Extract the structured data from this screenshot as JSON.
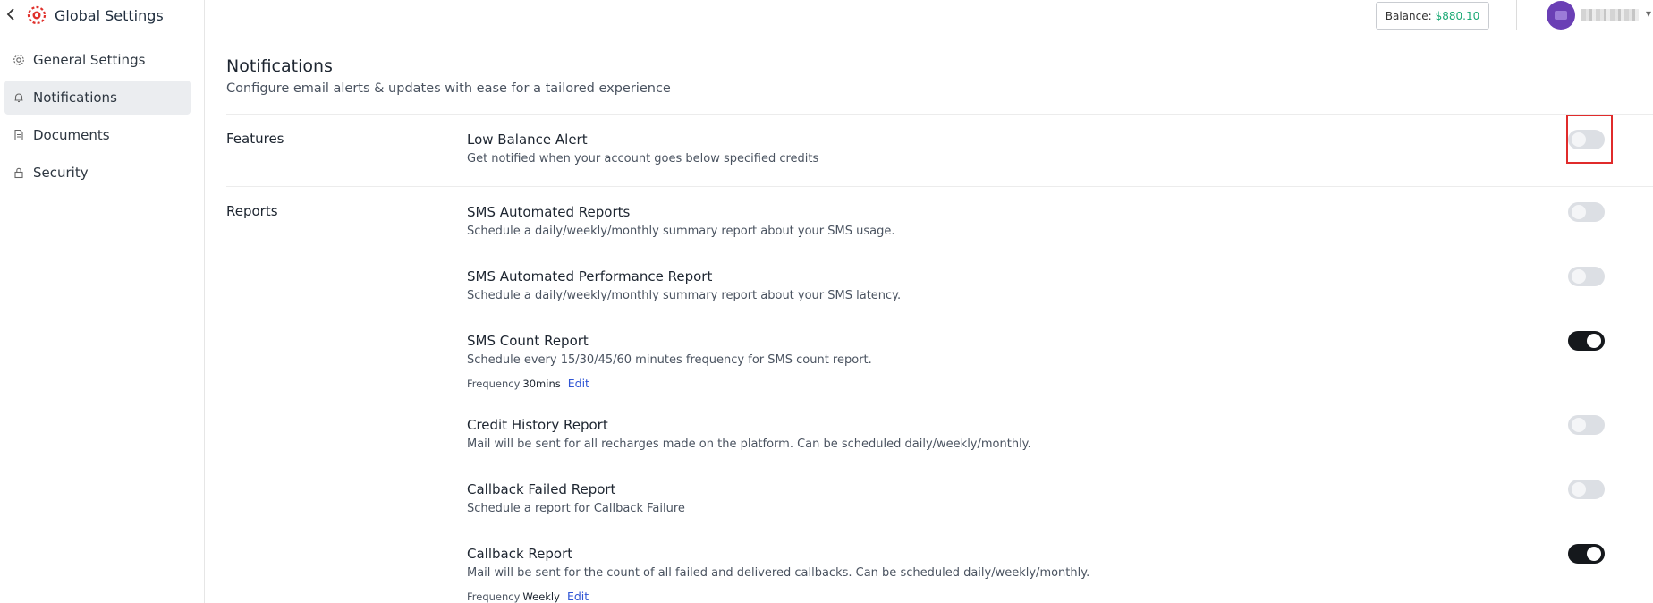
{
  "sidebar": {
    "title": "Global Settings",
    "items": [
      {
        "label": "General Settings",
        "icon": "gear-icon",
        "active": false
      },
      {
        "label": "Notifications",
        "icon": "bell-icon",
        "active": true
      },
      {
        "label": "Documents",
        "icon": "document-icon",
        "active": false
      },
      {
        "label": "Security",
        "icon": "lock-icon",
        "active": false
      }
    ]
  },
  "header": {
    "balance_label": "Balance:",
    "balance_amount": "$880.10",
    "balance_color": "#19a974",
    "avatar_color": "#6a3fb5"
  },
  "main": {
    "title": "Notifications",
    "subtitle": "Configure email alerts & updates with ease for a tailored experience",
    "sections": {
      "features": "Features",
      "reports": "Reports"
    },
    "rows": [
      {
        "title": "Low Balance Alert",
        "desc": "Get notified when your account goes below specified credits",
        "enabled": false
      },
      {
        "title": "SMS Automated Reports",
        "desc": "Schedule a daily/weekly/monthly summary report about your SMS usage.",
        "enabled": false
      },
      {
        "title": "SMS Automated Performance Report",
        "desc": "Schedule a daily/weekly/monthly summary report about your SMS latency.",
        "enabled": false
      },
      {
        "title": "SMS Count Report",
        "desc": "Schedule every 15/30/45/60 minutes frequency for SMS count report.",
        "enabled": true,
        "freq_label": "Frequency",
        "freq_value": "30mins",
        "edit_label": "Edit"
      },
      {
        "title": "Credit History Report",
        "desc": "Mail will be sent for all recharges made on the platform. Can be scheduled daily/weekly/monthly.",
        "enabled": false
      },
      {
        "title": "Callback Failed Report",
        "desc": "Schedule a report for Callback Failure",
        "enabled": false
      },
      {
        "title": "Callback Report",
        "desc": "Mail will be sent for the count of all failed and delivered callbacks. Can be scheduled daily/weekly/monthly.",
        "enabled": true,
        "freq_label": "Frequency",
        "freq_value": "Weekly",
        "edit_label": "Edit"
      }
    ]
  }
}
